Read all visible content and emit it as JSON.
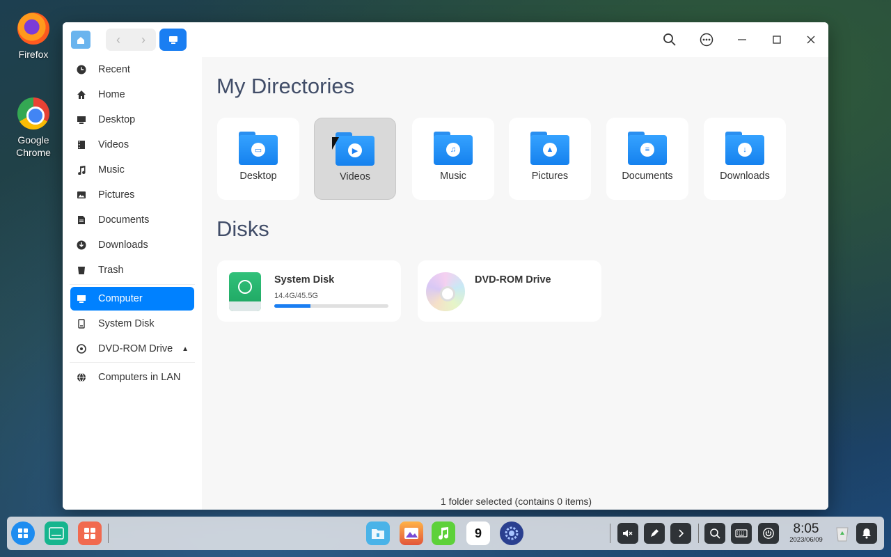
{
  "desktop": {
    "icons": [
      {
        "label": "Firefox"
      },
      {
        "label": "Google Chrome"
      }
    ]
  },
  "window": {
    "title_icon": "file-manager-icon",
    "nav": {
      "back": "‹",
      "forward": "›"
    },
    "toolbar_icons": [
      "search-icon",
      "more-options-icon",
      "minimize-icon",
      "maximize-icon",
      "close-icon"
    ]
  },
  "sidebar": {
    "items": [
      {
        "label": "Recent",
        "icon": "clock-icon"
      },
      {
        "label": "Home",
        "icon": "home-icon"
      },
      {
        "label": "Desktop",
        "icon": "desktop-icon"
      },
      {
        "label": "Videos",
        "icon": "video-icon"
      },
      {
        "label": "Music",
        "icon": "music-icon"
      },
      {
        "label": "Pictures",
        "icon": "picture-icon"
      },
      {
        "label": "Documents",
        "icon": "document-icon"
      },
      {
        "label": "Downloads",
        "icon": "download-icon"
      },
      {
        "label": "Trash",
        "icon": "trash-icon"
      },
      {
        "label": "Computer",
        "icon": "computer-icon",
        "active": true
      },
      {
        "label": "System Disk",
        "icon": "disk-icon"
      },
      {
        "label": "DVD-ROM Drive",
        "icon": "dvd-icon",
        "eject": "▲"
      },
      {
        "label": "Computers in LAN",
        "icon": "network-icon"
      }
    ]
  },
  "main": {
    "directories_title": "My Directories",
    "folders": [
      {
        "label": "Desktop",
        "icon": "desktop-folder-icon",
        "emblem": "▭"
      },
      {
        "label": "Videos",
        "icon": "videos-folder-icon",
        "emblem": "▶",
        "selected": true
      },
      {
        "label": "Music",
        "icon": "music-folder-icon",
        "emblem": "♫"
      },
      {
        "label": "Pictures",
        "icon": "pictures-folder-icon",
        "emblem": "▲"
      },
      {
        "label": "Documents",
        "icon": "documents-folder-icon",
        "emblem": "≡"
      },
      {
        "label": "Downloads",
        "icon": "downloads-folder-icon",
        "emblem": "↓"
      }
    ],
    "disks_title": "Disks",
    "disks": [
      {
        "name": "System Disk",
        "size": "14.4G/45.5G",
        "used_fraction": 0.316
      },
      {
        "name": "DVD-ROM Drive"
      }
    ],
    "status": "1 folder selected (contains 0 items)"
  },
  "taskbar": {
    "left": [
      "launcher-icon",
      "multitask-view-icon",
      "app-store-icon"
    ],
    "apps": [
      "file-manager-icon",
      "image-viewer-icon",
      "music-icon",
      "calendar-icon",
      "settings-icon"
    ],
    "calendar_day": "9",
    "tray": [
      "volume-muted-icon",
      "pen-icon",
      "expand-tray-icon",
      "search-icon",
      "keyboard-icon",
      "power-icon"
    ],
    "clock_time": "8:05",
    "clock_date": "2023/06/09",
    "right": [
      "trash-icon",
      "notification-icon"
    ]
  },
  "colors": {
    "accent": "#0081ff",
    "folder_blue": "#1a7ef2"
  }
}
